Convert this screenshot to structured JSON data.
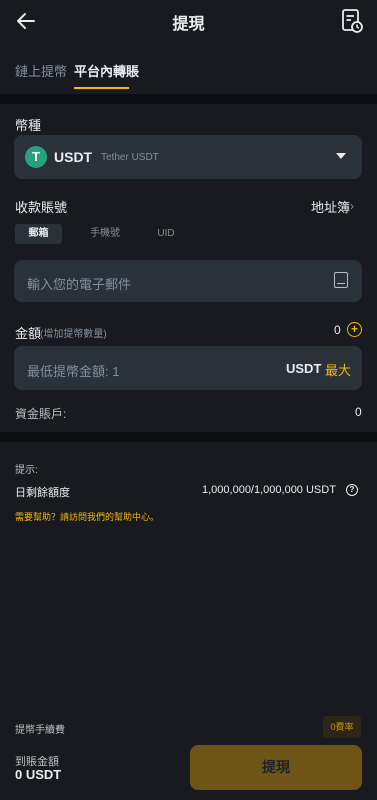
{
  "header": {
    "title": "提現"
  },
  "tabs": [
    {
      "label": "鏈上提幣",
      "active": false
    },
    {
      "label": "平台內轉賬",
      "active": true
    }
  ],
  "coin": {
    "label": "幣種",
    "symbol": "USDT",
    "name": "Tether USDT",
    "logo_glyph": "T",
    "logo_color": "#26a17b"
  },
  "recipient": {
    "label": "收款賬號",
    "address_book": "地址簿",
    "types": [
      "郵箱",
      "手機號",
      "UID"
    ],
    "selected_type": "郵箱",
    "email_placeholder": "輸入您的電子郵件"
  },
  "amount": {
    "label": "金額",
    "hint": "(增加提幣數量)",
    "value_display": "0",
    "placeholder": "最低提幣金額: 1",
    "unit": "USDT",
    "max_label": "最大"
  },
  "funding": {
    "label": "資金賬戶:",
    "value": "0"
  },
  "tips": {
    "label": "提示:",
    "daily_label": "日剩餘額度",
    "daily_value": "1,000,000/1,000,000 USDT",
    "help_link": "需要幫助？請訪問我們的幫助中心。"
  },
  "footer": {
    "fee_label": "提幣手續費",
    "fee_badge": "0費率",
    "received_label": "到賬金額",
    "received_value": "0 USDT",
    "submit_label": "提現"
  },
  "colors": {
    "accent": "#f0b90b",
    "background": "#181a20",
    "surface": "#2b3139",
    "muted": "#848e9c"
  }
}
